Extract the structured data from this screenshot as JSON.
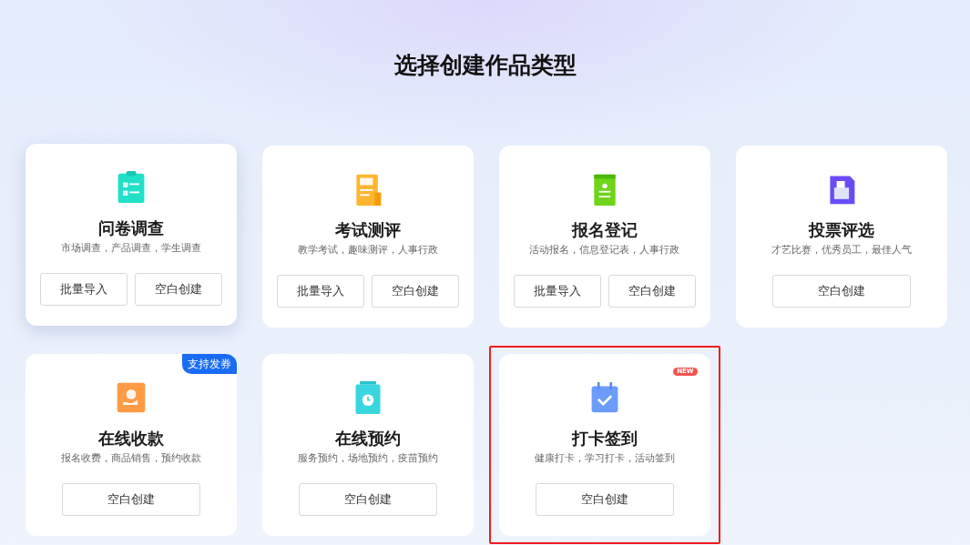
{
  "title": "选择创建作品类型",
  "cards": [
    {
      "title": "问卷调查",
      "subtitle": "市场调查，产品调查，学生调查",
      "hovered": true,
      "highlighted": false,
      "buttons": [
        "批量导入",
        "空白创建"
      ]
    },
    {
      "title": "考试测评",
      "subtitle": "教学考试，趣味测评，人事行政",
      "hovered": false,
      "highlighted": false,
      "buttons": [
        "批量导入",
        "空白创建"
      ]
    },
    {
      "title": "报名登记",
      "subtitle": "活动报名，信息登记表，人事行政",
      "hovered": false,
      "highlighted": false,
      "buttons": [
        "批量导入",
        "空白创建"
      ]
    },
    {
      "title": "投票评选",
      "subtitle": "才艺比赛，优秀员工，最佳人气",
      "hovered": false,
      "highlighted": false,
      "buttons": [
        "空白创建"
      ]
    },
    {
      "title": "在线收款",
      "subtitle": "报名收费，商品销售，预约收款",
      "hovered": false,
      "highlighted": false,
      "badge": {
        "kind": "corner",
        "text": "支持发券"
      },
      "buttons": [
        "空白创建"
      ]
    },
    {
      "title": "在线预约",
      "subtitle": "服务预约，场地预约，疫苗预约",
      "hovered": false,
      "highlighted": false,
      "buttons": [
        "空白创建"
      ]
    },
    {
      "title": "打卡签到",
      "subtitle": "健康打卡，学习打卡，活动签到",
      "hovered": false,
      "highlighted": true,
      "badge": {
        "kind": "pill",
        "text": "NEW"
      },
      "buttons": [
        "空白创建"
      ]
    }
  ]
}
